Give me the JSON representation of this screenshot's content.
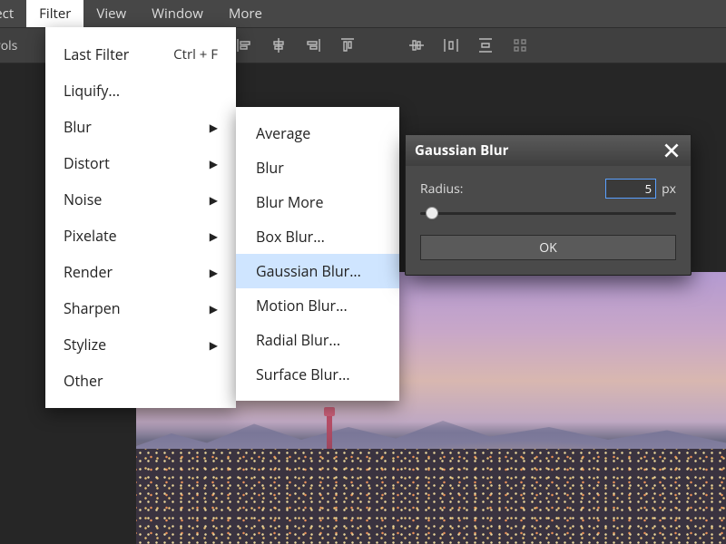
{
  "menubar": {
    "items": [
      "elect",
      "Filter",
      "View",
      "Window",
      "More"
    ],
    "active_index": 1
  },
  "toolbar": {
    "controls_label": "trols"
  },
  "filter_menu": {
    "last_filter": "Last Filter",
    "last_filter_shortcut": "Ctrl + F",
    "liquify": "Liquify...",
    "items": [
      {
        "label": "Blur",
        "submenu": true
      },
      {
        "label": "Distort",
        "submenu": true
      },
      {
        "label": "Noise",
        "submenu": true
      },
      {
        "label": "Pixelate",
        "submenu": true
      },
      {
        "label": "Render",
        "submenu": true
      },
      {
        "label": "Sharpen",
        "submenu": true
      },
      {
        "label": "Stylize",
        "submenu": true
      },
      {
        "label": "Other",
        "submenu": false
      }
    ],
    "active_item_index": 0
  },
  "blur_submenu": {
    "items": [
      "Average",
      "Blur",
      "Blur More",
      "Box Blur...",
      "Gaussian Blur...",
      "Motion Blur...",
      "Radial Blur...",
      "Surface Blur..."
    ],
    "selected_index": 4
  },
  "dialog": {
    "title": "Gaussian Blur",
    "radius_label": "Radius:",
    "radius_value": "5",
    "radius_unit": "px",
    "ok_label": "OK"
  }
}
